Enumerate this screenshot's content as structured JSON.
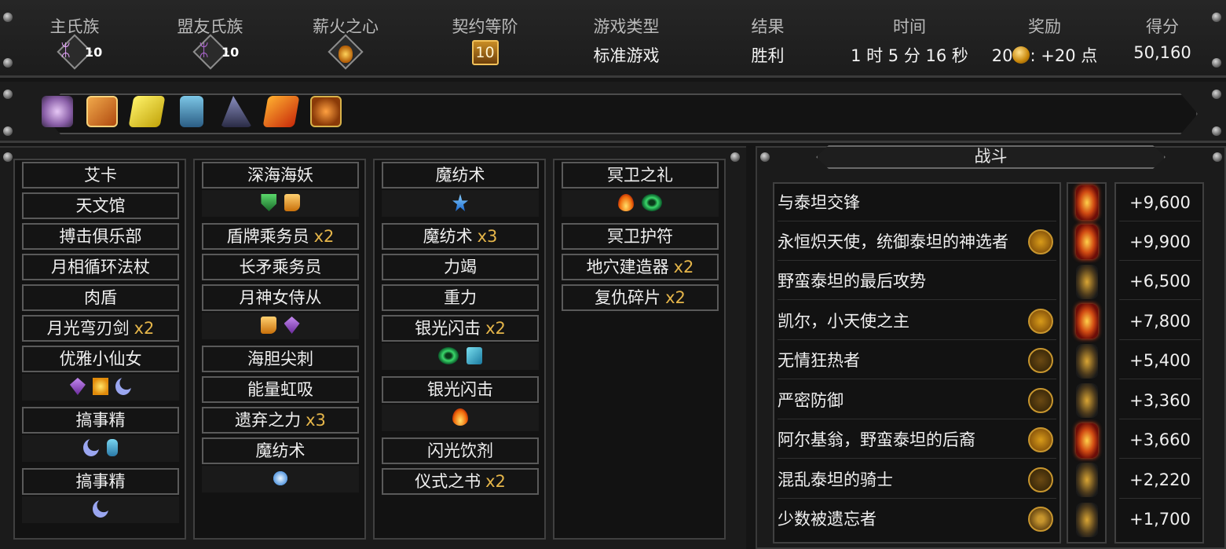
{
  "header": {
    "main_clan": {
      "label": "主氏族",
      "level": "10",
      "icon": "tentacle-clan-icon",
      "color": "#e9a6ff"
    },
    "ally_clan": {
      "label": "盟友氏族",
      "level": "10",
      "icon": "serpent-clan-icon",
      "color": "#b46ad8"
    },
    "pyre_heart": {
      "label": "薪火之心",
      "icon": "pyre-heart-icon"
    },
    "covenant": {
      "label": "契约等阶",
      "value": "10"
    },
    "game_type": {
      "label": "游戏类型",
      "value": "标准游戏"
    },
    "result": {
      "label": "结果",
      "value": "胜利"
    },
    "time": {
      "label": "时间",
      "value": "1 时 5 分 16 秒"
    },
    "reward": {
      "label": "奖励",
      "coins": "20",
      "points": ": +20 点"
    },
    "score": {
      "label": "得分",
      "value": "50,160"
    }
  },
  "relics": [
    {
      "icon": "crystal-cluster-relic-icon",
      "color": "#c99be6"
    },
    {
      "icon": "mystery-box-relic-icon",
      "color": "#e08a2c"
    },
    {
      "icon": "lightning-card-relic-icon",
      "color": "#e6d21a"
    },
    {
      "icon": "blue-totem-relic-icon",
      "color": "#4fa4c8"
    },
    {
      "icon": "dark-cone-relic-icon",
      "color": "#5b5e8a"
    },
    {
      "icon": "flame-card-relic-icon",
      "color": "#e85b12"
    },
    {
      "icon": "orange-orb-relic-icon",
      "color": "#d9731a"
    }
  ],
  "deck": {
    "col1": {
      "cards": [
        {
          "name": "艾卡",
          "count": ""
        },
        {
          "name": "天文馆",
          "count": ""
        },
        {
          "name": "搏击俱乐部",
          "count": ""
        },
        {
          "name": "月相循环法杖",
          "count": ""
        },
        {
          "name": "肉盾",
          "count": ""
        },
        {
          "name": "月光弯刃剑",
          "count": "x2"
        },
        {
          "name": "优雅小仙女",
          "count": ""
        },
        {
          "name": "搞事精",
          "count": ""
        },
        {
          "name": "搞事精",
          "count": ""
        }
      ]
    },
    "col2": {
      "cards": [
        {
          "name": "深海海妖",
          "count": ""
        },
        {
          "name": "盾牌乘务员",
          "count": "x2"
        },
        {
          "name": "长矛乘务员",
          "count": ""
        },
        {
          "name": "月神女侍从",
          "count": ""
        },
        {
          "name": "海胆尖刺",
          "count": ""
        },
        {
          "name": "能量虹吸",
          "count": ""
        },
        {
          "name": "遗弃之力",
          "count": "x3"
        },
        {
          "name": "魔纺术",
          "count": ""
        }
      ]
    },
    "col3": {
      "cards": [
        {
          "name": "魔纺术",
          "count": ""
        },
        {
          "name": "魔纺术",
          "count": "x3"
        },
        {
          "name": "力竭",
          "count": ""
        },
        {
          "name": "重力",
          "count": ""
        },
        {
          "name": "银光闪击",
          "count": "x2"
        },
        {
          "name": "银光闪击",
          "count": ""
        },
        {
          "name": "闪光饮剂",
          "count": ""
        },
        {
          "name": "仪式之书",
          "count": "x2"
        }
      ]
    },
    "col4": {
      "cards": [
        {
          "name": "冥卫之礼",
          "count": ""
        },
        {
          "name": "冥卫护符",
          "count": ""
        },
        {
          "name": "地穴建造器",
          "count": "x2"
        },
        {
          "name": "复仇碎片",
          "count": "x2"
        }
      ]
    }
  },
  "combat": {
    "title": "战斗",
    "battles": [
      {
        "name": "与泰坦交锋",
        "boss_icon": "",
        "difficulty": "high-flame-icon",
        "score": "+9,600"
      },
      {
        "name": "永恒炽天使，统御泰坦的神选者",
        "boss_icon": "seraph-boss-icon",
        "difficulty": "high-flame-icon",
        "score": "+9,900"
      },
      {
        "name": "野蛮泰坦的最后攻势",
        "boss_icon": "",
        "difficulty": "low-flame-icon",
        "score": "+6,500"
      },
      {
        "name": "凯尔，小天使之主",
        "boss_icon": "kel-boss-icon",
        "difficulty": "high-flame-icon",
        "score": "+7,800"
      },
      {
        "name": "无情狂热者",
        "boss_icon": "zealot-boss-icon",
        "difficulty": "low-flame-icon",
        "score": "+5,400"
      },
      {
        "name": "严密防御",
        "boss_icon": "defense-boss-icon",
        "difficulty": "low-flame-icon",
        "score": "+3,360"
      },
      {
        "name": "阿尔基翁，野蛮泰坦的后裔",
        "boss_icon": "alcyone-boss-icon",
        "difficulty": "high-flame-icon",
        "score": "+3,660"
      },
      {
        "name": "混乱泰坦的骑士",
        "boss_icon": "knight-boss-icon",
        "difficulty": "low-flame-icon",
        "score": "+2,220"
      },
      {
        "name": "少数被遗忘者",
        "boss_icon": "hive-boss-icon",
        "difficulty": "low-flame-icon",
        "score": "+1,700"
      }
    ]
  }
}
